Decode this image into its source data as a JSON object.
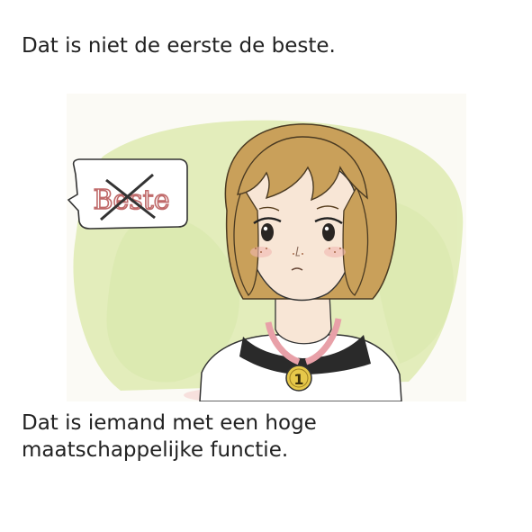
{
  "captions": {
    "top": "Dat is niet de eerste de beste.",
    "bottom": "Dat is iemand met een hoge\nmaatschappelijke functie."
  },
  "illustration": {
    "speech_bubble_word": "Beste",
    "medal_number": "1",
    "colors": {
      "background_wash": "#d6e6a0",
      "hair": "#c9a05a",
      "skin": "#f8e6d6",
      "ribbon": "#e8a0a8",
      "medal": "#e6c84a",
      "shirt": "#ffffff",
      "collar_dark": "#2a2a2a"
    }
  }
}
